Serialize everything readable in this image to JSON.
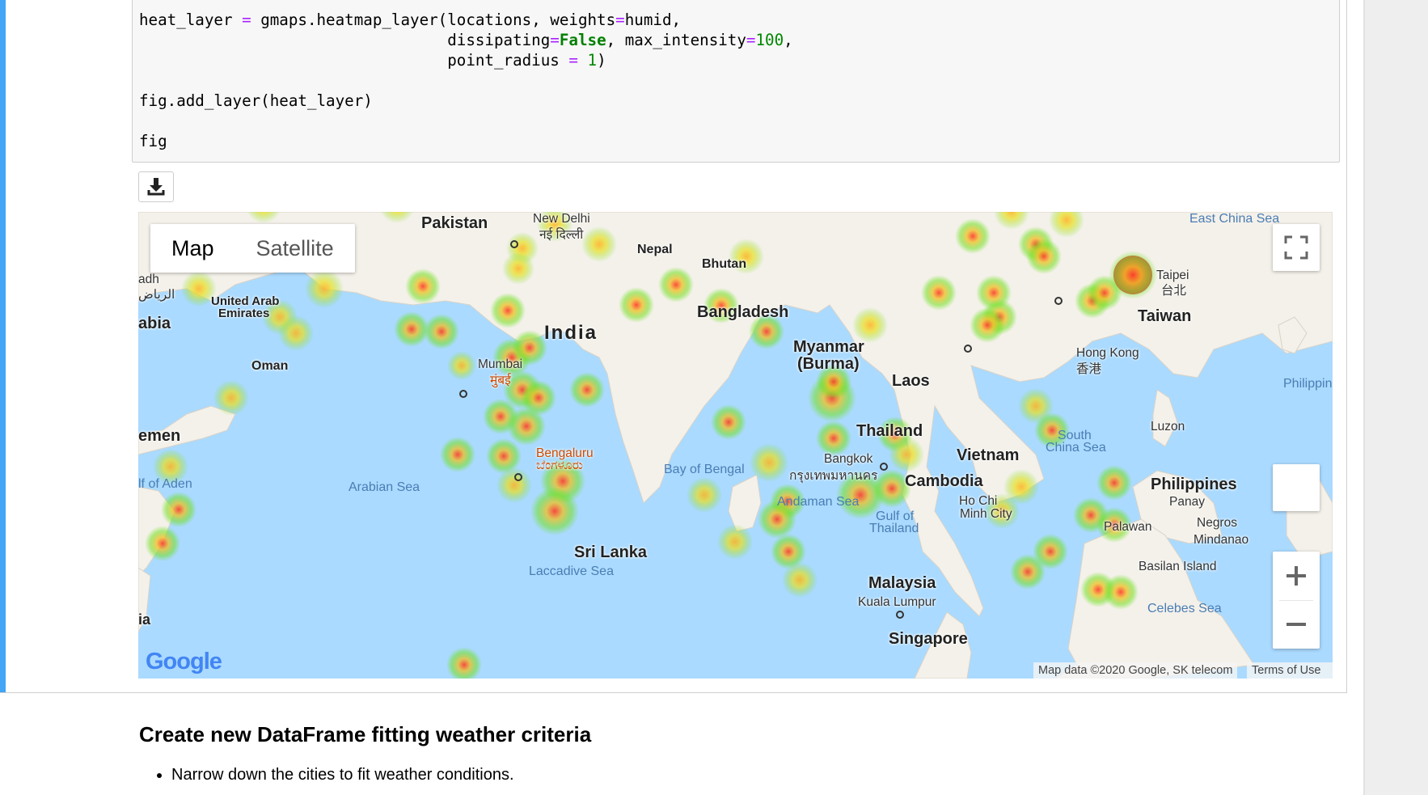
{
  "code": {
    "lines": [
      {
        "plain": "heat_layer ",
        "op": "=",
        "rest": " gmaps.heatmap_layer(locations, weights",
        "op2": "=",
        "rest2": "humid,"
      },
      {
        "pad": "                                 ",
        "a": "dissipating",
        "op": "=",
        "bool": "False",
        "b": ", max_intensity",
        "op2": "=",
        "num": "100",
        "c": ","
      },
      {
        "pad": "                                 ",
        "a": "point_radius ",
        "op": "=",
        "sp": " ",
        "num": "1",
        "c": ")"
      },
      {
        "text": ""
      },
      {
        "text": "fig.add_layer(heat_layer)"
      },
      {
        "text": ""
      },
      {
        "text": "fig"
      }
    ]
  },
  "toolbar": {
    "download_icon": "download-icon"
  },
  "map": {
    "type_buttons": [
      {
        "label": "Map",
        "selected": true
      },
      {
        "label": "Satellite",
        "selected": false
      }
    ],
    "countries": [
      "Pakistan",
      "India",
      "Nepal",
      "Bhutan",
      "Bangladesh",
      "Myanmar",
      "(Burma)",
      "Laos",
      "Thailand",
      "Vietnam",
      "Cambodia",
      "Sri Lanka",
      "Malaysia",
      "Singapore",
      "Taiwan",
      "Philippines",
      "Oman",
      "United Arab",
      "Emirates",
      "abia",
      "emen",
      "ia"
    ],
    "cities": [
      "New Delhi",
      "नई दिल्ली",
      "Mumbai",
      "मुंबई",
      "Bengaluru",
      "ಬೆಂಗಳೂರು",
      "Bangkok",
      "กรุงเทพมหานคร",
      "Ho Chi",
      "Minh City",
      "Kuala Lumpur",
      "Hong Kong",
      "香港",
      "Taipei",
      "台北",
      "Luzon",
      "Panay",
      "Negros",
      "Palawan",
      "Mindanao",
      "Basilan Island",
      "adh",
      "الرياض"
    ],
    "seas": [
      "Arabian Sea",
      "Bay of Bengal",
      "Andaman Sea",
      "Gulf of",
      "Thailand",
      "Laccadive Sea",
      "South",
      "China Sea",
      "East China Sea",
      "Celebes Sea",
      "Philippin",
      "lf of Aden"
    ],
    "icons": {
      "fullscreen": "fullscreen-icon",
      "zoom_in": "plus-icon",
      "zoom_out": "minus-icon"
    },
    "attribution": "Map data ©2020 Google, SK telecom",
    "terms": "Terms of Use",
    "logo": "Google"
  },
  "markdown": {
    "heading": "Create new DataFrame fitting weather criteria",
    "bullets": [
      "Narrow down the cities to fit weather conditions."
    ]
  }
}
